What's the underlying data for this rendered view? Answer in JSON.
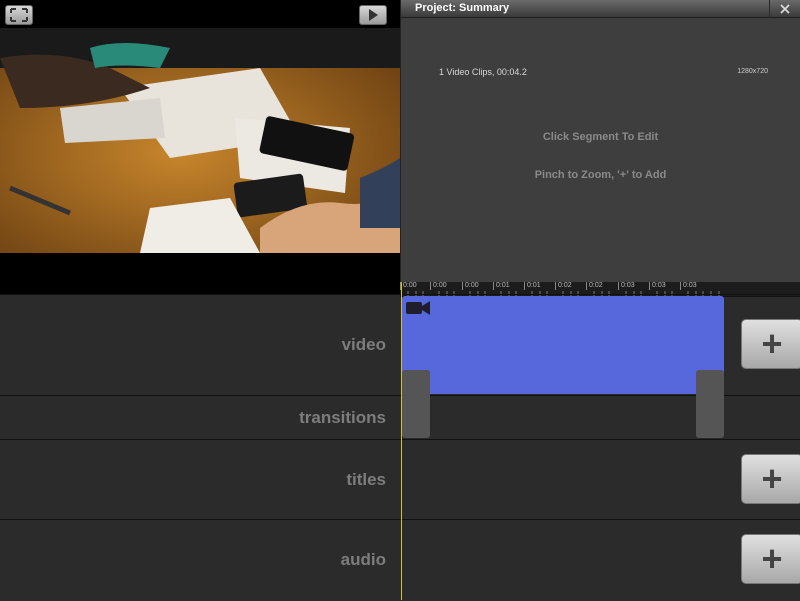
{
  "preview": {
    "fullscreen_icon": "fullscreen-icon",
    "play_icon": "play-icon"
  },
  "summary": {
    "title": "Project: Summary",
    "close_icon": "close-icon",
    "clip_info": "1 Video Clips, 00:04.2",
    "resolution": "1280x720",
    "hint_edit": "Click Segment To Edit",
    "hint_zoom": "Pinch to Zoom, '+' to Add"
  },
  "ruler": {
    "ticks": [
      "0:00",
      "0:00",
      "0:00",
      "0:01",
      "0:01",
      "0:02",
      "0:02",
      "0:03",
      "0:03",
      "0:03"
    ]
  },
  "tracks": {
    "video": "video",
    "transitions": "transitions",
    "titles": "titles",
    "audio": "audio"
  },
  "buttons": {
    "add_label": "+"
  },
  "colors": {
    "clip": "#5767dc",
    "playhead": "#d4c020",
    "background": "#2b2b2b"
  }
}
